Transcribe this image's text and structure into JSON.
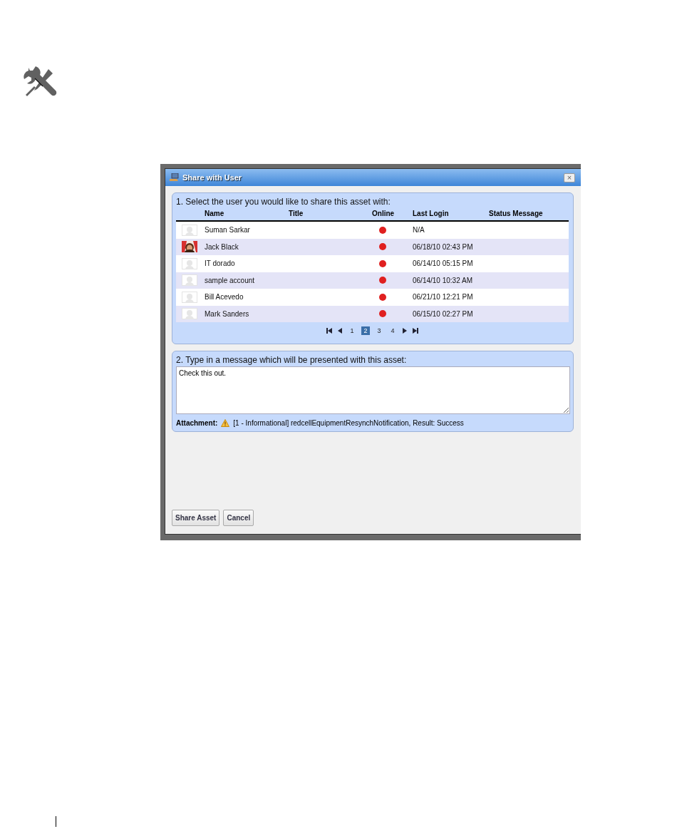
{
  "dialog": {
    "title": "Share with User",
    "close": "×",
    "user_section": {
      "heading": "1. Select the user you would like to share this asset with:",
      "columns": [
        "Name",
        "Title",
        "Online",
        "Last Login",
        "Status Message"
      ],
      "rows": [
        {
          "kind": "placeholder",
          "name": "Suman Sarkar",
          "online": false,
          "last_login": "N/A"
        },
        {
          "name": "Jack Black",
          "online": false,
          "last_login": "06/18/10 02:43 PM"
        },
        {
          "kind": "placeholder",
          "name": "IT dorado",
          "online": false,
          "last_login": "06/14/10 05:15 PM"
        },
        {
          "kind": "placeholder",
          "name": "sample account",
          "online": false,
          "last_login": "06/14/10 10:32 AM"
        },
        {
          "kind": "placeholder",
          "name": "Bill Acevedo",
          "online": false,
          "last_login": "06/21/10 12:21 PM"
        },
        {
          "kind": "placeholder",
          "name": "Mark Sanders",
          "online": false,
          "last_login": "06/15/10 02:27 PM"
        }
      ],
      "pages": [
        {
          "label": "1",
          "selected": false
        },
        {
          "label": "2",
          "selected": true
        },
        {
          "label": "3",
          "selected": false
        },
        {
          "label": "4",
          "selected": false
        }
      ]
    },
    "message_section": {
      "heading": "2. Type in a message which will be presented with this asset:",
      "value": "Check this out.",
      "attachment_label": "Attachment:",
      "attachment": "[1 - Informational] redcellEquipmentResynchNotification, Result: Success"
    },
    "buttons": [
      "Share Asset",
      "Cancel"
    ]
  }
}
